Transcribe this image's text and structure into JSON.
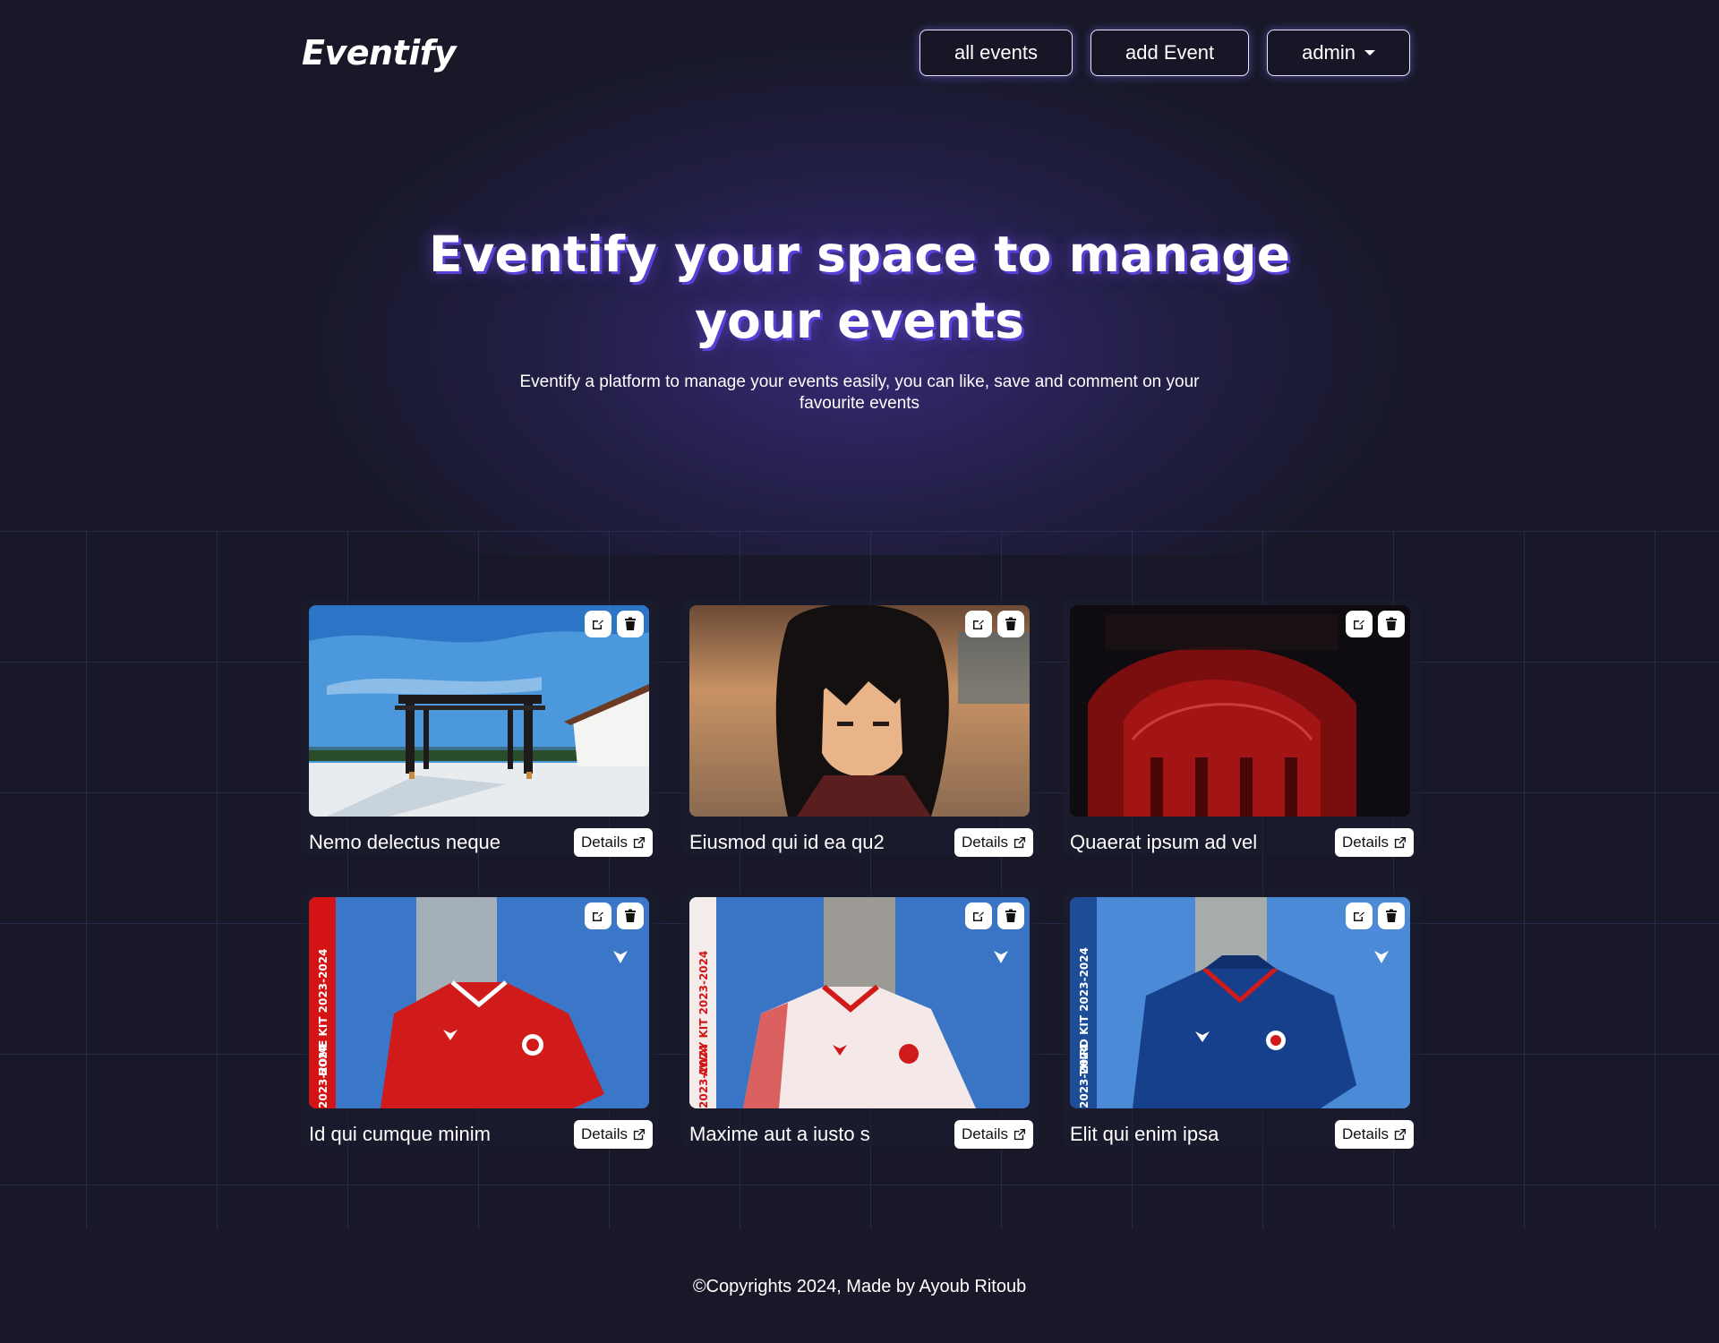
{
  "header": {
    "logo": "Eventify",
    "nav": {
      "all_events": "all events",
      "add_event": "add Event",
      "admin": "admin"
    }
  },
  "hero": {
    "title": "Eventify your space to manage your events",
    "subtitle": "Eventify a platform to manage your events easily, you can like, save and comment on your favourite events"
  },
  "events": [
    {
      "title": "Nemo delectus neque",
      "details": "Details",
      "image": "pergola-terrace"
    },
    {
      "title": "Eiusmod qui id ea qu2",
      "details": "Details",
      "image": "anime-character"
    },
    {
      "title": "Quaerat ipsum ad vel",
      "details": "Details",
      "image": "red-lit-building"
    },
    {
      "title": "Id qui cumque minim",
      "details": "Details",
      "image": "home-kit-jersey",
      "banner": "HOME KIT 2023-2024",
      "banner_short": "2023-2024"
    },
    {
      "title": "Maxime aut a iusto s",
      "details": "Details",
      "image": "away-kit-jersey",
      "banner": "AWAY KIT 2023-2024",
      "banner_short": "2023-2024"
    },
    {
      "title": "Elit qui enim ipsa",
      "details": "Details",
      "image": "third-kit-jersey",
      "banner": "THIRD KIT 2023-2024",
      "banner_short": "2023-2024"
    }
  ],
  "footer": {
    "text": "©Copyrights 2024, Made by Ayoub Ritoub"
  },
  "colors": {
    "background": "#181828",
    "accent_glow": "#5a3fd6",
    "button_bg": "#ffffff"
  }
}
